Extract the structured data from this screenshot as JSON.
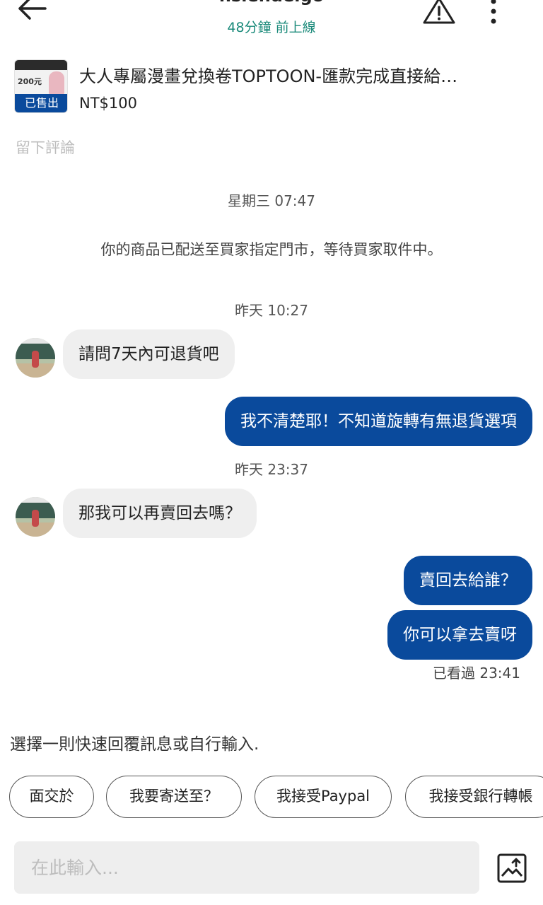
{
  "header": {
    "username": "hsiehdeigo",
    "status": "48分鐘 前上線"
  },
  "listing": {
    "thumb_price": "200元",
    "sold_label": "已售出",
    "title": "大人專屬漫畫兌換卷TOPTOON-匯款完成直接給…",
    "price": "NT$100"
  },
  "leave_review": "留下評論",
  "messages": {
    "ts1": "星期三 07:47",
    "system": "你的商品已配送至買家指定門市，等待買家取件中。",
    "ts2": "昨天 10:27",
    "m1": "請問7天內可退貨吧",
    "m2": "我不清楚耶！不知道旋轉有無退貨選項",
    "ts3": "昨天 23:37",
    "m3": "那我可以再賣回去嗎？",
    "m4": "賣回去給誰？",
    "m5": "你可以拿去賣呀",
    "seen": "已看過 23:41"
  },
  "quick_replies": {
    "title": "選擇一則快速回覆訊息或自行輸入.",
    "chips": [
      "面交於",
      "我要寄送至？",
      "我接受Paypal",
      "我接受銀行轉帳"
    ]
  },
  "input": {
    "placeholder": "在此輸入..."
  },
  "colors": {
    "brand_blue": "#0a4a9c",
    "online_green": "#1a8a7a"
  },
  "icons": {
    "back": "arrow-left-icon",
    "report": "warning-triangle-icon",
    "more": "more-vertical-icon",
    "image": "image-upload-icon"
  }
}
